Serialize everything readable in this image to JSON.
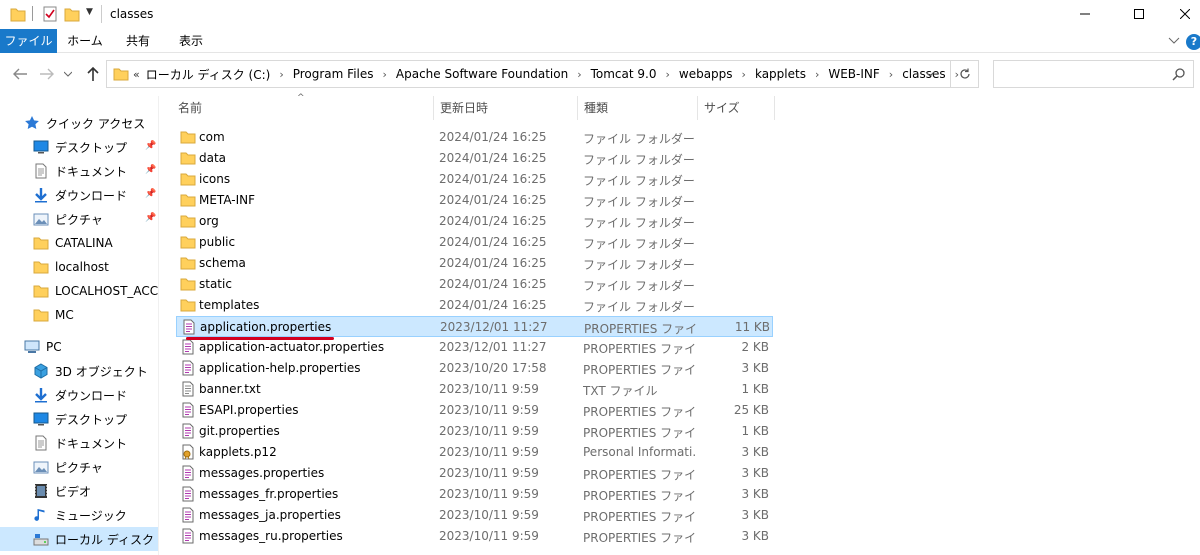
{
  "window": {
    "title": "classes"
  },
  "ribbon": {
    "tabs": [
      "ファイル",
      "ホーム",
      "共有",
      "表示"
    ]
  },
  "address": {
    "overflow": "«",
    "crumbs": [
      "ローカル ディスク (C:)",
      "Program Files",
      "Apache Software Foundation",
      "Tomcat 9.0",
      "webapps",
      "kapplets",
      "WEB-INF",
      "classes"
    ]
  },
  "search": {
    "placeholder": ""
  },
  "sidebar": {
    "items": [
      {
        "label": "クイック アクセス",
        "icon": "star-icon",
        "pinned": false,
        "indent": 1
      },
      {
        "label": "デスクトップ",
        "icon": "desktop-icon",
        "pinned": true,
        "indent": 2
      },
      {
        "label": "ドキュメント",
        "icon": "document-icon",
        "pinned": true,
        "indent": 2
      },
      {
        "label": "ダウンロード",
        "icon": "download-icon",
        "pinned": true,
        "indent": 2
      },
      {
        "label": "ピクチャ",
        "icon": "picture-icon",
        "pinned": true,
        "indent": 2
      },
      {
        "label": "CATALINA",
        "icon": "folder-icon",
        "pinned": false,
        "indent": 2
      },
      {
        "label": "localhost",
        "icon": "folder-icon",
        "pinned": false,
        "indent": 2
      },
      {
        "label": "LOCALHOST_ACCES",
        "icon": "folder-icon",
        "pinned": false,
        "indent": 2
      },
      {
        "label": "MC",
        "icon": "folder-icon",
        "pinned": false,
        "indent": 2
      },
      {
        "label": "PC",
        "icon": "pc-icon",
        "pinned": false,
        "indent": 1
      },
      {
        "label": "3D オブジェクト",
        "icon": "cube-icon",
        "pinned": false,
        "indent": 2
      },
      {
        "label": "ダウンロード",
        "icon": "download-icon",
        "pinned": false,
        "indent": 2
      },
      {
        "label": "デスクトップ",
        "icon": "desktop-icon",
        "pinned": false,
        "indent": 2
      },
      {
        "label": "ドキュメント",
        "icon": "document-icon",
        "pinned": false,
        "indent": 2
      },
      {
        "label": "ピクチャ",
        "icon": "picture-icon",
        "pinned": false,
        "indent": 2
      },
      {
        "label": "ビデオ",
        "icon": "video-icon",
        "pinned": false,
        "indent": 2
      },
      {
        "label": "ミュージック",
        "icon": "music-icon",
        "pinned": false,
        "indent": 2
      },
      {
        "label": "ローカル ディスク (C:)",
        "icon": "drive-icon",
        "pinned": false,
        "indent": 2,
        "selected": true
      }
    ]
  },
  "columns": {
    "name": "名前",
    "date": "更新日時",
    "type": "種類",
    "size": "サイズ"
  },
  "files": [
    {
      "name": "com",
      "date": "2024/01/24 16:25",
      "type": "ファイル フォルダー",
      "size": "",
      "icon": "folder-icon"
    },
    {
      "name": "data",
      "date": "2024/01/24 16:25",
      "type": "ファイル フォルダー",
      "size": "",
      "icon": "folder-icon"
    },
    {
      "name": "icons",
      "date": "2024/01/24 16:25",
      "type": "ファイル フォルダー",
      "size": "",
      "icon": "folder-icon"
    },
    {
      "name": "META-INF",
      "date": "2024/01/24 16:25",
      "type": "ファイル フォルダー",
      "size": "",
      "icon": "folder-icon"
    },
    {
      "name": "org",
      "date": "2024/01/24 16:25",
      "type": "ファイル フォルダー",
      "size": "",
      "icon": "folder-icon"
    },
    {
      "name": "public",
      "date": "2024/01/24 16:25",
      "type": "ファイル フォルダー",
      "size": "",
      "icon": "folder-icon"
    },
    {
      "name": "schema",
      "date": "2024/01/24 16:25",
      "type": "ファイル フォルダー",
      "size": "",
      "icon": "folder-icon"
    },
    {
      "name": "static",
      "date": "2024/01/24 16:25",
      "type": "ファイル フォルダー",
      "size": "",
      "icon": "folder-icon"
    },
    {
      "name": "templates",
      "date": "2024/01/24 16:25",
      "type": "ファイル フォルダー",
      "size": "",
      "icon": "folder-icon"
    },
    {
      "name": "application.properties",
      "date": "2023/12/01 11:27",
      "type": "PROPERTIES ファイル",
      "size": "11 KB",
      "icon": "properties-file-icon",
      "selected": true
    },
    {
      "name": "application-actuator.properties",
      "date": "2023/12/01 11:27",
      "type": "PROPERTIES ファイル",
      "size": "2 KB",
      "icon": "properties-file-icon"
    },
    {
      "name": "application-help.properties",
      "date": "2023/10/20 17:58",
      "type": "PROPERTIES ファイル",
      "size": "3 KB",
      "icon": "properties-file-icon"
    },
    {
      "name": "banner.txt",
      "date": "2023/10/11 9:59",
      "type": "TXT ファイル",
      "size": "1 KB",
      "icon": "text-file-icon"
    },
    {
      "name": "ESAPI.properties",
      "date": "2023/10/11 9:59",
      "type": "PROPERTIES ファイル",
      "size": "25 KB",
      "icon": "properties-file-icon"
    },
    {
      "name": "git.properties",
      "date": "2023/10/11 9:59",
      "type": "PROPERTIES ファイル",
      "size": "1 KB",
      "icon": "properties-file-icon"
    },
    {
      "name": "kapplets.p12",
      "date": "2023/10/11 9:59",
      "type": "Personal Informati...",
      "size": "3 KB",
      "icon": "certificate-file-icon"
    },
    {
      "name": "messages.properties",
      "date": "2023/10/11 9:59",
      "type": "PROPERTIES ファイル",
      "size": "3 KB",
      "icon": "properties-file-icon"
    },
    {
      "name": "messages_fr.properties",
      "date": "2023/10/11 9:59",
      "type": "PROPERTIES ファイル",
      "size": "3 KB",
      "icon": "properties-file-icon"
    },
    {
      "name": "messages_ja.properties",
      "date": "2023/10/11 9:59",
      "type": "PROPERTIES ファイル",
      "size": "3 KB",
      "icon": "properties-file-icon"
    },
    {
      "name": "messages_ru.properties",
      "date": "2023/10/11 9:59",
      "type": "PROPERTIES ファイル",
      "size": "3 KB",
      "icon": "properties-file-icon"
    }
  ],
  "colors": {
    "accent": "#1979ca",
    "selection": "#cce8ff",
    "selection_border": "#99d1ff",
    "folder": "#ffd05c",
    "annotation": "#d2001f"
  }
}
